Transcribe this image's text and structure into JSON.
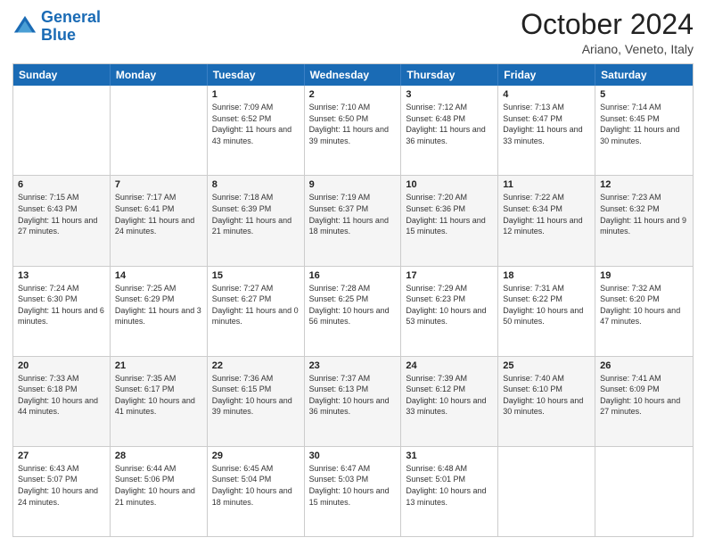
{
  "header": {
    "logo_general": "General",
    "logo_blue": "Blue",
    "month": "October 2024",
    "location": "Ariano, Veneto, Italy"
  },
  "days_of_week": [
    "Sunday",
    "Monday",
    "Tuesday",
    "Wednesday",
    "Thursday",
    "Friday",
    "Saturday"
  ],
  "weeks": [
    [
      {
        "day": "",
        "empty": true
      },
      {
        "day": "",
        "empty": true
      },
      {
        "day": "1",
        "sunrise": "Sunrise: 7:09 AM",
        "sunset": "Sunset: 6:52 PM",
        "daylight": "Daylight: 11 hours and 43 minutes."
      },
      {
        "day": "2",
        "sunrise": "Sunrise: 7:10 AM",
        "sunset": "Sunset: 6:50 PM",
        "daylight": "Daylight: 11 hours and 39 minutes."
      },
      {
        "day": "3",
        "sunrise": "Sunrise: 7:12 AM",
        "sunset": "Sunset: 6:48 PM",
        "daylight": "Daylight: 11 hours and 36 minutes."
      },
      {
        "day": "4",
        "sunrise": "Sunrise: 7:13 AM",
        "sunset": "Sunset: 6:47 PM",
        "daylight": "Daylight: 11 hours and 33 minutes."
      },
      {
        "day": "5",
        "sunrise": "Sunrise: 7:14 AM",
        "sunset": "Sunset: 6:45 PM",
        "daylight": "Daylight: 11 hours and 30 minutes."
      }
    ],
    [
      {
        "day": "6",
        "sunrise": "Sunrise: 7:15 AM",
        "sunset": "Sunset: 6:43 PM",
        "daylight": "Daylight: 11 hours and 27 minutes."
      },
      {
        "day": "7",
        "sunrise": "Sunrise: 7:17 AM",
        "sunset": "Sunset: 6:41 PM",
        "daylight": "Daylight: 11 hours and 24 minutes."
      },
      {
        "day": "8",
        "sunrise": "Sunrise: 7:18 AM",
        "sunset": "Sunset: 6:39 PM",
        "daylight": "Daylight: 11 hours and 21 minutes."
      },
      {
        "day": "9",
        "sunrise": "Sunrise: 7:19 AM",
        "sunset": "Sunset: 6:37 PM",
        "daylight": "Daylight: 11 hours and 18 minutes."
      },
      {
        "day": "10",
        "sunrise": "Sunrise: 7:20 AM",
        "sunset": "Sunset: 6:36 PM",
        "daylight": "Daylight: 11 hours and 15 minutes."
      },
      {
        "day": "11",
        "sunrise": "Sunrise: 7:22 AM",
        "sunset": "Sunset: 6:34 PM",
        "daylight": "Daylight: 11 hours and 12 minutes."
      },
      {
        "day": "12",
        "sunrise": "Sunrise: 7:23 AM",
        "sunset": "Sunset: 6:32 PM",
        "daylight": "Daylight: 11 hours and 9 minutes."
      }
    ],
    [
      {
        "day": "13",
        "sunrise": "Sunrise: 7:24 AM",
        "sunset": "Sunset: 6:30 PM",
        "daylight": "Daylight: 11 hours and 6 minutes."
      },
      {
        "day": "14",
        "sunrise": "Sunrise: 7:25 AM",
        "sunset": "Sunset: 6:29 PM",
        "daylight": "Daylight: 11 hours and 3 minutes."
      },
      {
        "day": "15",
        "sunrise": "Sunrise: 7:27 AM",
        "sunset": "Sunset: 6:27 PM",
        "daylight": "Daylight: 11 hours and 0 minutes."
      },
      {
        "day": "16",
        "sunrise": "Sunrise: 7:28 AM",
        "sunset": "Sunset: 6:25 PM",
        "daylight": "Daylight: 10 hours and 56 minutes."
      },
      {
        "day": "17",
        "sunrise": "Sunrise: 7:29 AM",
        "sunset": "Sunset: 6:23 PM",
        "daylight": "Daylight: 10 hours and 53 minutes."
      },
      {
        "day": "18",
        "sunrise": "Sunrise: 7:31 AM",
        "sunset": "Sunset: 6:22 PM",
        "daylight": "Daylight: 10 hours and 50 minutes."
      },
      {
        "day": "19",
        "sunrise": "Sunrise: 7:32 AM",
        "sunset": "Sunset: 6:20 PM",
        "daylight": "Daylight: 10 hours and 47 minutes."
      }
    ],
    [
      {
        "day": "20",
        "sunrise": "Sunrise: 7:33 AM",
        "sunset": "Sunset: 6:18 PM",
        "daylight": "Daylight: 10 hours and 44 minutes."
      },
      {
        "day": "21",
        "sunrise": "Sunrise: 7:35 AM",
        "sunset": "Sunset: 6:17 PM",
        "daylight": "Daylight: 10 hours and 41 minutes."
      },
      {
        "day": "22",
        "sunrise": "Sunrise: 7:36 AM",
        "sunset": "Sunset: 6:15 PM",
        "daylight": "Daylight: 10 hours and 39 minutes."
      },
      {
        "day": "23",
        "sunrise": "Sunrise: 7:37 AM",
        "sunset": "Sunset: 6:13 PM",
        "daylight": "Daylight: 10 hours and 36 minutes."
      },
      {
        "day": "24",
        "sunrise": "Sunrise: 7:39 AM",
        "sunset": "Sunset: 6:12 PM",
        "daylight": "Daylight: 10 hours and 33 minutes."
      },
      {
        "day": "25",
        "sunrise": "Sunrise: 7:40 AM",
        "sunset": "Sunset: 6:10 PM",
        "daylight": "Daylight: 10 hours and 30 minutes."
      },
      {
        "day": "26",
        "sunrise": "Sunrise: 7:41 AM",
        "sunset": "Sunset: 6:09 PM",
        "daylight": "Daylight: 10 hours and 27 minutes."
      }
    ],
    [
      {
        "day": "27",
        "sunrise": "Sunrise: 6:43 AM",
        "sunset": "Sunset: 5:07 PM",
        "daylight": "Daylight: 10 hours and 24 minutes."
      },
      {
        "day": "28",
        "sunrise": "Sunrise: 6:44 AM",
        "sunset": "Sunset: 5:06 PM",
        "daylight": "Daylight: 10 hours and 21 minutes."
      },
      {
        "day": "29",
        "sunrise": "Sunrise: 6:45 AM",
        "sunset": "Sunset: 5:04 PM",
        "daylight": "Daylight: 10 hours and 18 minutes."
      },
      {
        "day": "30",
        "sunrise": "Sunrise: 6:47 AM",
        "sunset": "Sunset: 5:03 PM",
        "daylight": "Daylight: 10 hours and 15 minutes."
      },
      {
        "day": "31",
        "sunrise": "Sunrise: 6:48 AM",
        "sunset": "Sunset: 5:01 PM",
        "daylight": "Daylight: 10 hours and 13 minutes."
      },
      {
        "day": "",
        "empty": true
      },
      {
        "day": "",
        "empty": true
      }
    ]
  ]
}
